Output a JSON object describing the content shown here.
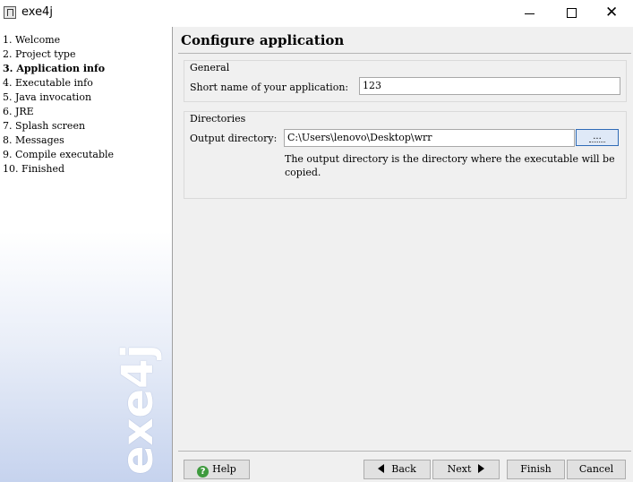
{
  "window": {
    "title": "exe4j",
    "icon": "exe4j-app-icon",
    "controls": {
      "minimize": "minimize-icon",
      "maximize": "maximize-icon",
      "close": "close-icon",
      "close_glyph": "✕"
    }
  },
  "sidebar": {
    "steps": [
      {
        "label": "1.  Welcome"
      },
      {
        "label": "2.  Project type"
      },
      {
        "label": "3.  Application info"
      },
      {
        "label": "4.  Executable info"
      },
      {
        "label": "5.  Java invocation"
      },
      {
        "label": "6.  JRE"
      },
      {
        "label": "7.  Splash screen"
      },
      {
        "label": "8.  Messages"
      },
      {
        "label": "9.  Compile executable"
      },
      {
        "label": "10.  Finished"
      }
    ],
    "active_index": 2,
    "brand": "exe4j"
  },
  "main": {
    "heading": "Configure application",
    "general": {
      "title": "General",
      "short_name_label": "Short name of your application:",
      "short_name_value": "123"
    },
    "directories": {
      "title": "Directories",
      "output_label": "Output directory:",
      "output_value": "C:\\Users\\lenovo\\Desktop\\wrr",
      "browse_label": "...",
      "hint": "The output directory is the directory where the executable will be copied."
    }
  },
  "buttons": {
    "help": "Help",
    "help_icon": "?",
    "back": "Back",
    "next": "Next",
    "finish": "Finish",
    "cancel": "Cancel"
  },
  "colors": {
    "sidebar_gradient_end": "#c6d3ee",
    "browse_border": "#2f6bb6",
    "help_icon": "#3e9a3e"
  }
}
